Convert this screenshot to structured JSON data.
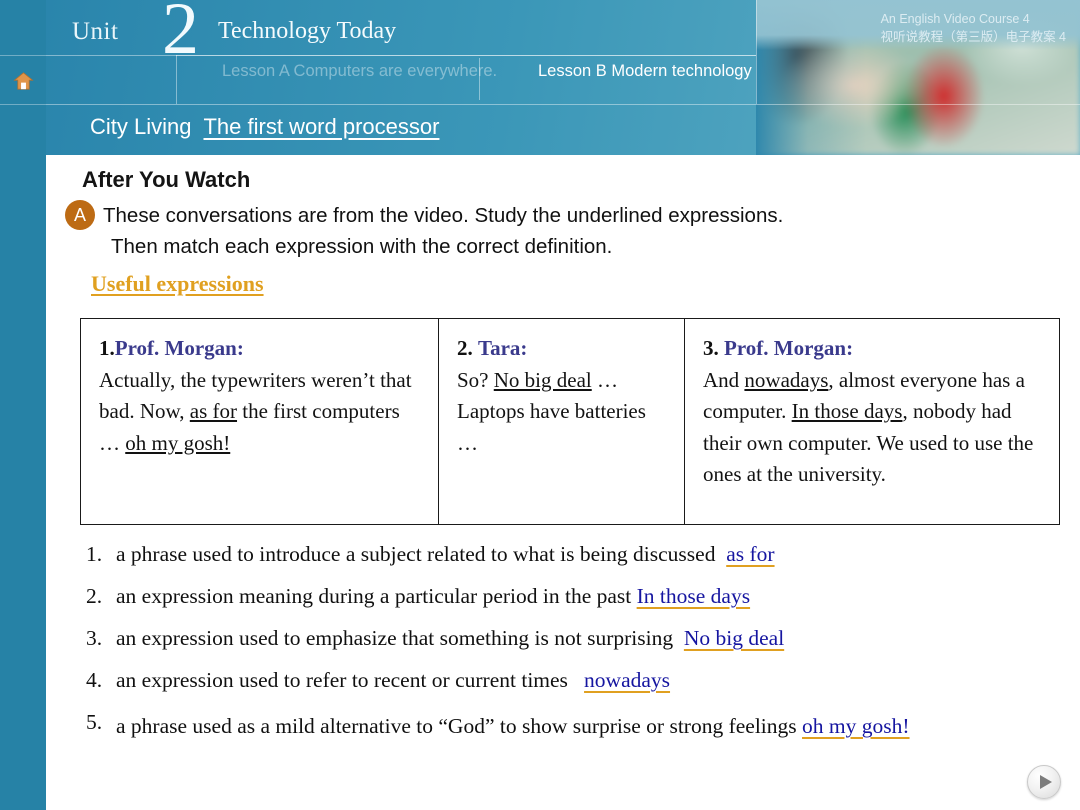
{
  "header": {
    "unit_word": "Unit",
    "unit_number": "2",
    "course_title": "Technology Today",
    "course_meta_line1": "An English Video Course 4",
    "course_meta_line2": "视听说教程（第三版）电子教案 4",
    "tabs": [
      {
        "label": "Lesson A Computers are everywhere.",
        "active": false
      },
      {
        "label": "Lesson B Modern technology",
        "active": true
      }
    ],
    "subtitle_segment_1": "City Living",
    "subtitle_segment_2": "The first word processor",
    "home_icon": "home-icon",
    "accent_color": "#2a85ac"
  },
  "main": {
    "section_title": "After You Watch",
    "task_badge": "A",
    "instruction_line1": "These conversations are from the video. Study the underlined expressions.",
    "instruction_line2": "Then match each expression with the correct definition.",
    "useful_expressions_link": "Useful expressions",
    "link_color": "#e0a020"
  },
  "conversations": [
    {
      "number": "1.",
      "speaker": "Prof. Morgan:",
      "parts": [
        {
          "text": "Actually, the typewriters weren’t that bad. Now, ",
          "underline": false
        },
        {
          "text": "as for",
          "underline": true
        },
        {
          "text": " the first computers … ",
          "underline": false
        },
        {
          "text": "oh my gosh!",
          "underline": true
        }
      ]
    },
    {
      "number": "2.",
      "speaker": "Tara:",
      "parts": [
        {
          "text": "So? ",
          "underline": false
        },
        {
          "text": "No big deal",
          "underline": true
        },
        {
          "text": " … Laptops have batteries …",
          "underline": false
        }
      ]
    },
    {
      "number": "3.",
      "speaker": "Prof. Morgan:",
      "parts": [
        {
          "text": "And ",
          "underline": false
        },
        {
          "text": "nowadays",
          "underline": true
        },
        {
          "text": ", almost everyone has a computer. ",
          "underline": false
        },
        {
          "text": "In those days",
          "underline": true
        },
        {
          "text": ", nobody had their own computer. We used to use the ones at the university.",
          "underline": false
        }
      ]
    }
  ],
  "definitions": [
    {
      "number": "1.",
      "text": "a phrase used to introduce a subject related to what is being discussed",
      "answer": "as for"
    },
    {
      "number": "2.",
      "text": "an expression meaning during a particular period in the past",
      "answer": "In those days"
    },
    {
      "number": "3.",
      "text": "an expression used to emphasize that something is not surprising",
      "answer": "No big deal"
    },
    {
      "number": "4.",
      "text": "an expression used to refer to recent or current times",
      "answer": "nowadays"
    },
    {
      "number": "5.",
      "text": "a phrase used as a mild alternative to “God” to show surprise or strong feelings",
      "answer": "oh my gosh!"
    }
  ],
  "controls": {
    "play_button": "play-icon"
  }
}
